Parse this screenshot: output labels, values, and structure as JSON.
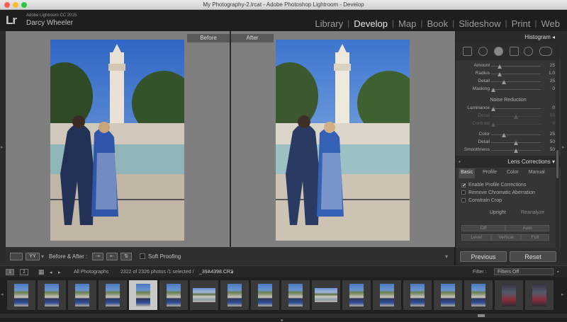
{
  "window": {
    "title": "My Photography-2.lrcat - Adobe Photoshop Lightroom - Develop"
  },
  "identity": {
    "logo": "Lr",
    "app_name": "Adobe Lightroom CC 2015",
    "user_name": "Darcy Wheeler"
  },
  "modules": [
    {
      "label": "Library"
    },
    {
      "label": "Develop"
    },
    {
      "label": "Map"
    },
    {
      "label": "Book"
    },
    {
      "label": "Slideshow"
    },
    {
      "label": "Print"
    },
    {
      "label": "Web"
    }
  ],
  "canvas": {
    "before_label": "Before",
    "after_label": "After"
  },
  "toolbar": {
    "view_mode": "YY",
    "before_after_label": "Before & After :",
    "soft_proofing_label": "Soft Proofing"
  },
  "right_panel": {
    "histogram_label": "Histogram",
    "sharpening": [
      {
        "label": "Amount",
        "value": "25",
        "pos": 0.17
      },
      {
        "label": "Radius",
        "value": "1.0",
        "pos": 0.17
      },
      {
        "label": "Detail",
        "value": "25",
        "pos": 0.25
      },
      {
        "label": "Masking",
        "value": "0",
        "pos": 0.02
      }
    ],
    "noise_reduction_title": "Noise Reduction",
    "noise": [
      {
        "label": "Luminance",
        "value": "0",
        "pos": 0.02
      },
      {
        "label": "Detail",
        "value": "50",
        "pos": 0.5
      },
      {
        "label": "Contrast",
        "value": "0",
        "pos": 0.02
      },
      {
        "label": "Color",
        "value": "25",
        "pos": 0.25
      },
      {
        "label": "Detail",
        "value": "50",
        "pos": 0.5
      },
      {
        "label": "Smoothness",
        "value": "50",
        "pos": 0.5
      }
    ],
    "lens_corrections_label": "Lens Corrections",
    "lens_tabs": [
      {
        "label": "Basic"
      },
      {
        "label": "Profile"
      },
      {
        "label": "Color"
      },
      {
        "label": "Manual"
      }
    ],
    "lens_options": [
      {
        "label": "Enable Profile Corrections",
        "checked": "✔"
      },
      {
        "label": "Remove Chromatic Aberration",
        "checked": ""
      },
      {
        "label": "Constrain Crop",
        "checked": ""
      }
    ],
    "upright_label": "Upright",
    "reanalyze_label": "Reanalyze",
    "upright_buttons": [
      {
        "label": "Off"
      },
      {
        "label": "Auto"
      },
      {
        "label": "Level"
      },
      {
        "label": "Vertical"
      },
      {
        "label": "Full"
      }
    ],
    "previous_label": "Previous",
    "reset_label": "Reset"
  },
  "filmstrip": {
    "page1": "1",
    "page2": "2",
    "source": "All Photographs",
    "count_text": "2322 of 2326 photos /1 selected /",
    "filename": "_39A4398.CR2",
    "filter_label": "Filter :",
    "filter_value": "Filters Off",
    "thumbnails": 18,
    "selected_index": 4
  }
}
